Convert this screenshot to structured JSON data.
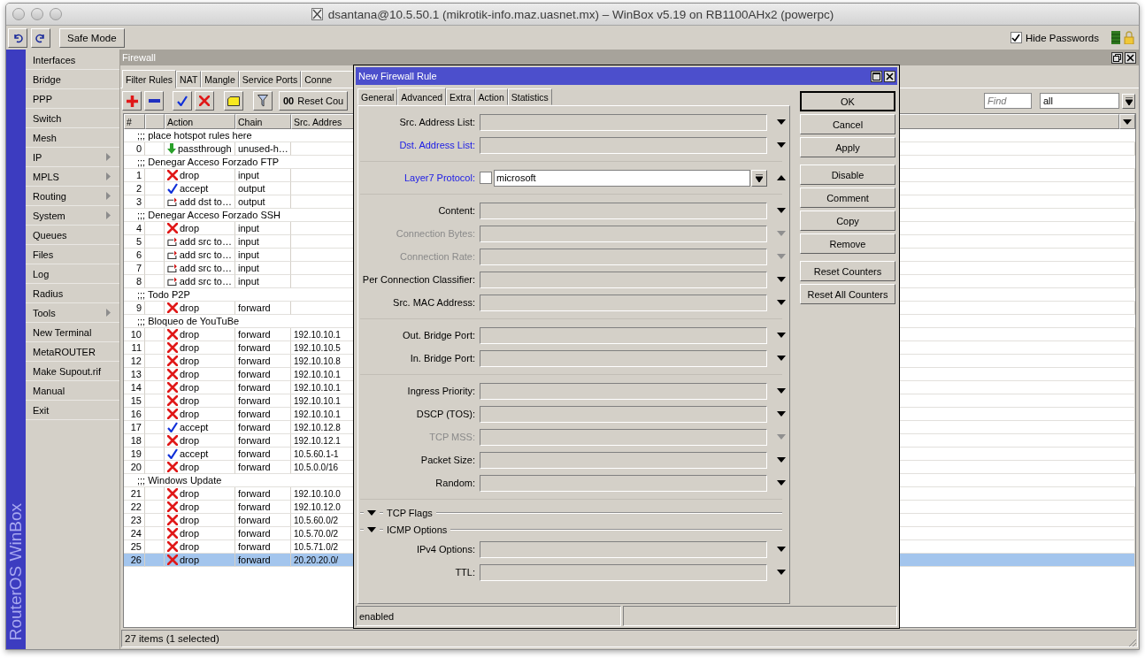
{
  "window": {
    "title": "dsantana@10.5.50.1 (mikrotik-info.maz.uasnet.mx) – WinBox v5.19 on RB1100AHx2 (powerpc)",
    "safe_mode": "Safe Mode",
    "hide_passwords": {
      "label": "Hide Passwords",
      "checked": true
    }
  },
  "sidebar": {
    "brand": "RouterOS WinBox",
    "items": [
      {
        "label": "Interfaces",
        "submenu": false
      },
      {
        "label": "Bridge",
        "submenu": false
      },
      {
        "label": "PPP",
        "submenu": false
      },
      {
        "label": "Switch",
        "submenu": false
      },
      {
        "label": "Mesh",
        "submenu": false
      },
      {
        "label": "IP",
        "submenu": true
      },
      {
        "label": "MPLS",
        "submenu": true
      },
      {
        "label": "Routing",
        "submenu": true
      },
      {
        "label": "System",
        "submenu": true
      },
      {
        "label": "Queues",
        "submenu": false
      },
      {
        "label": "Files",
        "submenu": false
      },
      {
        "label": "Log",
        "submenu": false
      },
      {
        "label": "Radius",
        "submenu": false
      },
      {
        "label": "Tools",
        "submenu": true
      },
      {
        "label": "New Terminal",
        "submenu": false
      },
      {
        "label": "MetaROUTER",
        "submenu": false
      },
      {
        "label": "Make Supout.rif",
        "submenu": false
      },
      {
        "label": "Manual",
        "submenu": false
      },
      {
        "label": "Exit",
        "submenu": false
      }
    ]
  },
  "firewall": {
    "title": "Firewall",
    "tabs": [
      {
        "label": "Filter Rules",
        "selected": true
      },
      {
        "label": "NAT",
        "selected": false
      },
      {
        "label": "Mangle",
        "selected": false
      },
      {
        "label": "Service Ports",
        "selected": false
      },
      {
        "label": "Conne",
        "selected": false
      }
    ],
    "toolbar": {
      "reset_icon": "00",
      "reset_label": "Reset Cou",
      "find_placeholder": "Find",
      "filter": "all"
    },
    "columns": [
      "#",
      "Action",
      "Chain",
      "Src. Addres"
    ],
    "rows": [
      {
        "kind": "comment",
        "text": ";;; place hotspot rules here",
        "selected": false
      },
      {
        "kind": "passthrough",
        "number": "0",
        "action": "passthrough",
        "chain": "unused-h…",
        "selected": false
      },
      {
        "kind": "comment",
        "text": ";;; Denegar Acceso Forzado FTP",
        "selected": false
      },
      {
        "kind": "drop",
        "number": "1",
        "action": "drop",
        "chain": "input",
        "selected": false
      },
      {
        "kind": "accept",
        "number": "2",
        "action": "accept",
        "chain": "output",
        "selected": false
      },
      {
        "kind": "add-list",
        "number": "3",
        "action": "add dst to…",
        "chain": "output",
        "selected": false
      },
      {
        "kind": "comment",
        "text": ";;; Denegar Acceso Forzado SSH",
        "selected": false
      },
      {
        "kind": "drop",
        "number": "4",
        "action": "drop",
        "chain": "input",
        "selected": false
      },
      {
        "kind": "add-list",
        "number": "5",
        "action": "add src to…",
        "chain": "input",
        "selected": false
      },
      {
        "kind": "add-list",
        "number": "6",
        "action": "add src to…",
        "chain": "input",
        "selected": false
      },
      {
        "kind": "add-list",
        "number": "7",
        "action": "add src to…",
        "chain": "input",
        "selected": false
      },
      {
        "kind": "add-list",
        "number": "8",
        "action": "add src to…",
        "chain": "input",
        "selected": false
      },
      {
        "kind": "comment",
        "text": ";;; Todo P2P",
        "selected": false
      },
      {
        "kind": "drop",
        "number": "9",
        "action": "drop",
        "chain": "forward",
        "selected": false
      },
      {
        "kind": "comment",
        "text": ";;; Bloqueo de YouTuBe",
        "selected": false
      },
      {
        "kind": "drop",
        "number": "10",
        "action": "drop",
        "chain": "forward",
        "src_address": "192.10.10.1",
        "selected": false
      },
      {
        "kind": "drop",
        "number": "11",
        "action": "drop",
        "chain": "forward",
        "src_address": "192.10.10.5",
        "selected": false
      },
      {
        "kind": "drop",
        "number": "12",
        "action": "drop",
        "chain": "forward",
        "src_address": "192.10.10.8",
        "selected": false
      },
      {
        "kind": "drop",
        "number": "13",
        "action": "drop",
        "chain": "forward",
        "src_address": "192.10.10.1",
        "selected": false
      },
      {
        "kind": "drop",
        "number": "14",
        "action": "drop",
        "chain": "forward",
        "src_address": "192.10.10.1",
        "selected": false
      },
      {
        "kind": "drop",
        "number": "15",
        "action": "drop",
        "chain": "forward",
        "src_address": "192.10.10.1",
        "selected": false
      },
      {
        "kind": "drop",
        "number": "16",
        "action": "drop",
        "chain": "forward",
        "src_address": "192.10.10.1",
        "selected": false
      },
      {
        "kind": "accept",
        "number": "17",
        "action": "accept",
        "chain": "forward",
        "src_address": "192.10.12.8",
        "selected": false
      },
      {
        "kind": "drop",
        "number": "18",
        "action": "drop",
        "chain": "forward",
        "src_address": "192.10.12.1",
        "selected": false
      },
      {
        "kind": "accept",
        "number": "19",
        "action": "accept",
        "chain": "forward",
        "src_address": "10.5.60.1-1",
        "selected": false
      },
      {
        "kind": "drop",
        "number": "20",
        "action": "drop",
        "chain": "forward",
        "src_address": "10.5.0.0/16",
        "selected": false
      },
      {
        "kind": "comment",
        "text": ";;; Windows Update",
        "selected": false
      },
      {
        "kind": "drop",
        "number": "21",
        "action": "drop",
        "chain": "forward",
        "src_address": "192.10.10.0",
        "selected": false
      },
      {
        "kind": "drop",
        "number": "22",
        "action": "drop",
        "chain": "forward",
        "src_address": "192.10.12.0",
        "selected": false
      },
      {
        "kind": "drop",
        "number": "23",
        "action": "drop",
        "chain": "forward",
        "src_address": "10.5.60.0/2",
        "selected": false
      },
      {
        "kind": "drop",
        "number": "24",
        "action": "drop",
        "chain": "forward",
        "src_address": "10.5.70.0/2",
        "selected": false
      },
      {
        "kind": "drop",
        "number": "25",
        "action": "drop",
        "chain": "forward",
        "src_address": "10.5.71.0/2",
        "selected": false
      },
      {
        "kind": "drop",
        "number": "26",
        "action": "drop",
        "chain": "forward",
        "src_address": "20.20.20.0/",
        "selected": true
      }
    ],
    "status": "27 items (1 selected)"
  },
  "dialog": {
    "title": "New Firewall Rule",
    "tabs": [
      {
        "label": "General",
        "selected": false
      },
      {
        "label": "Advanced",
        "selected": true
      },
      {
        "label": "Extra",
        "selected": false
      },
      {
        "label": "Action",
        "selected": false
      },
      {
        "label": "Statistics",
        "selected": false
      }
    ],
    "form_groups": [
      [
        {
          "kind": "field",
          "label": "Src. Address List:",
          "disabled": false,
          "highlighted": false,
          "expanded": false
        },
        {
          "kind": "field",
          "label": "Dst. Address List:",
          "disabled": false,
          "highlighted": true,
          "expanded": false
        }
      ],
      [
        {
          "kind": "combo",
          "label": "Layer7 Protocol:",
          "value": "microsoft",
          "negated": false,
          "disabled": false,
          "highlighted": true,
          "expanded": true
        }
      ],
      [
        {
          "kind": "field",
          "label": "Content:",
          "disabled": false,
          "highlighted": false,
          "expanded": false
        },
        {
          "kind": "field",
          "label": "Connection Bytes:",
          "disabled": true,
          "highlighted": false,
          "expanded": false
        },
        {
          "kind": "field",
          "label": "Connection Rate:",
          "disabled": true,
          "highlighted": false,
          "expanded": false
        },
        {
          "kind": "field",
          "label": "Per Connection Classifier:",
          "disabled": false,
          "highlighted": false,
          "expanded": false
        },
        {
          "kind": "field",
          "label": "Src. MAC Address:",
          "disabled": false,
          "highlighted": false,
          "expanded": false
        }
      ],
      [
        {
          "kind": "field",
          "label": "Out. Bridge Port:",
          "disabled": false,
          "highlighted": false,
          "expanded": false
        },
        {
          "kind": "field",
          "label": "In. Bridge Port:",
          "disabled": false,
          "highlighted": false,
          "expanded": false
        }
      ],
      [
        {
          "kind": "field",
          "label": "Ingress Priority:",
          "disabled": false,
          "highlighted": false,
          "expanded": false
        },
        {
          "kind": "field",
          "label": "DSCP (TOS):",
          "disabled": false,
          "highlighted": false,
          "expanded": false
        },
        {
          "kind": "field",
          "label": "TCP MSS:",
          "disabled": true,
          "highlighted": false,
          "expanded": false
        },
        {
          "kind": "field",
          "label": "Packet Size:",
          "disabled": false,
          "highlighted": false,
          "expanded": false
        },
        {
          "kind": "field",
          "label": "Random:",
          "disabled": false,
          "highlighted": false,
          "expanded": false
        }
      ],
      [
        {
          "kind": "section",
          "label": "TCP Flags"
        },
        {
          "kind": "section",
          "label": "ICMP Options"
        },
        {
          "kind": "field",
          "label": "IPv4 Options:",
          "disabled": false,
          "highlighted": false,
          "expanded": false
        },
        {
          "kind": "field",
          "label": "TTL:",
          "disabled": false,
          "highlighted": false,
          "expanded": false
        }
      ]
    ],
    "button_groups": [
      [
        {
          "label": "OK",
          "default": true
        },
        {
          "label": "Cancel",
          "default": false
        },
        {
          "label": "Apply",
          "default": false
        }
      ],
      [
        {
          "label": "Disable",
          "default": false
        },
        {
          "label": "Comment",
          "default": false
        },
        {
          "label": "Copy",
          "default": false
        },
        {
          "label": "Remove",
          "default": false
        }
      ],
      [
        {
          "label": "Reset Counters",
          "default": false
        },
        {
          "label": "Reset All Counters",
          "default": false
        }
      ]
    ],
    "status": "enabled"
  }
}
